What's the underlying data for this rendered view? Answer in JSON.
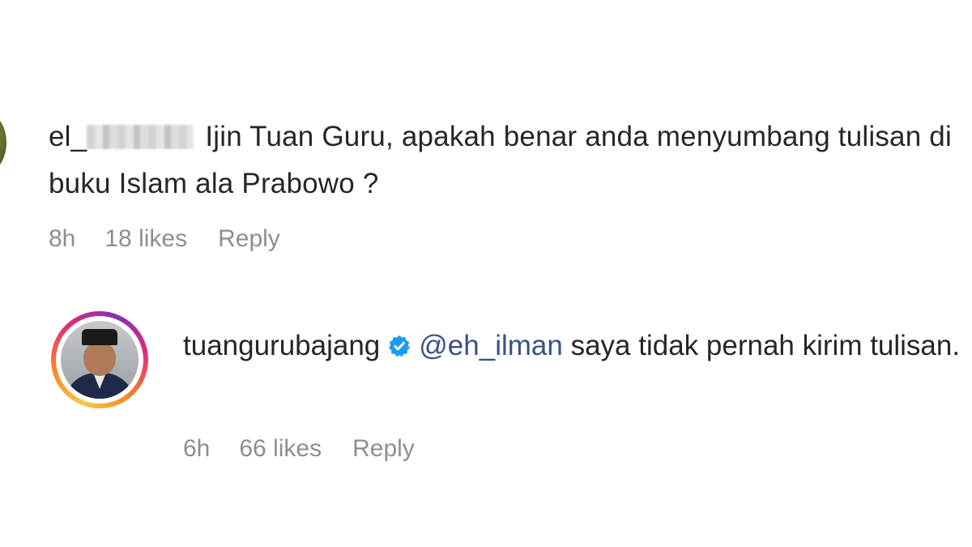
{
  "comment": {
    "username_visible": "el",
    "username_tail": "_",
    "text": "Ijin Tuan Guru, apakah benar anda menyumbang tulisan di buku Islam ala Prabowo ?",
    "time": "8h",
    "likes": "18 likes",
    "reply_label": "Reply"
  },
  "reply": {
    "username": "tuangurubajang",
    "mention": "@eh_ilman",
    "text": "saya tidak pernah kirim tulisan.",
    "time": "6h",
    "likes": "66 likes",
    "reply_label": "Reply"
  },
  "colors": {
    "text": "#262626",
    "meta": "#8e8e8e",
    "mention": "#385185",
    "verified": "#1d9bf0"
  },
  "icons": {
    "verified": "verified-badge-icon"
  }
}
